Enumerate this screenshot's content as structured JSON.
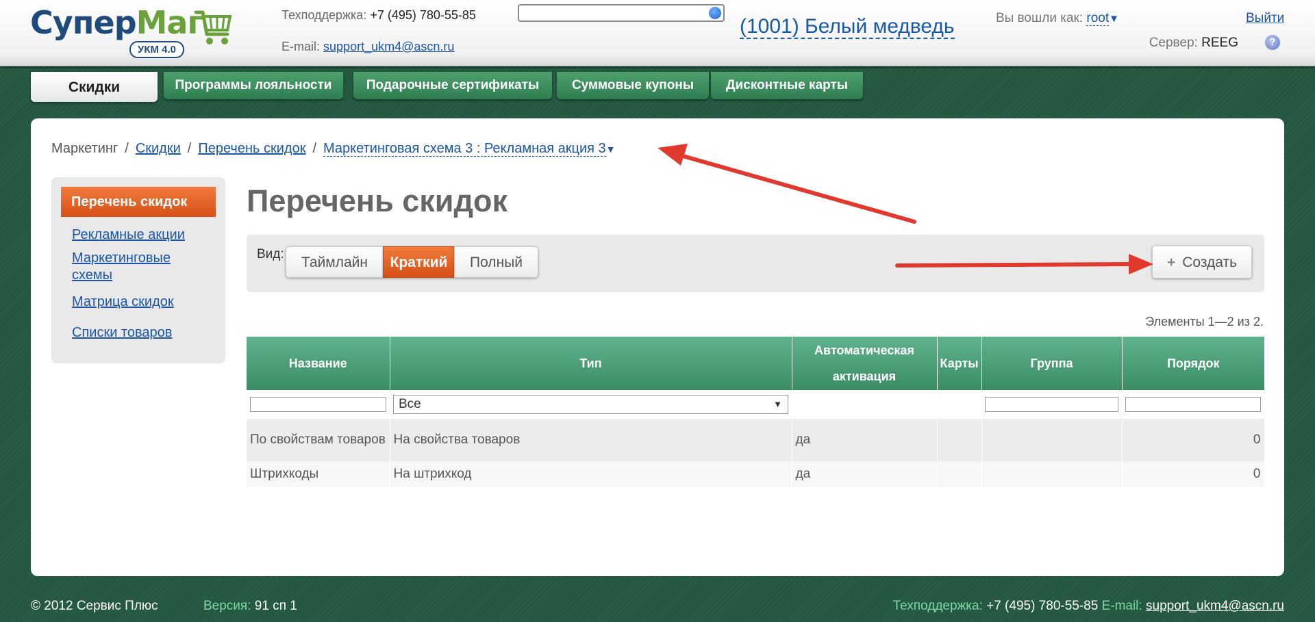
{
  "header": {
    "logo_part1": "Супер",
    "logo_part2": "Маг",
    "logo_badge": "УКМ 4.0",
    "support_label": "Техподдержка:",
    "support_phone": "+7 (495) 780-55-85",
    "email_label": "E-mail:",
    "email": "support_ukm4@ascn.ru",
    "search_value": "",
    "store": "(1001) Белый медведь",
    "logged_in_label": "Вы вошли как:",
    "user": "root",
    "logout": "Выйти",
    "server_label": "Сервер:",
    "server": "REEG",
    "help": "?"
  },
  "tabs": [
    {
      "label": "Скидки",
      "active": true
    },
    {
      "label": "Программы лояльности"
    },
    {
      "label": "Подарочные сертификаты"
    },
    {
      "label": "Суммовые купоны"
    },
    {
      "label": "Дисконтные карты"
    }
  ],
  "breadcrumb": [
    "Маркетинг",
    "Скидки",
    "Перечень скидок",
    "Маркетинговая схема 3 : Рекламная акция 3"
  ],
  "breadcrumb_sep": "/",
  "sidebar": {
    "active": "Перечень скидок",
    "items": [
      "Рекламные акции",
      "Маркетинговые схемы",
      "Матрица скидок",
      "Списки товаров"
    ]
  },
  "page_title": "Перечень скидок",
  "view": {
    "label": "Вид:",
    "options": [
      "Таймлайн",
      "Краткий",
      "Полный"
    ],
    "selected": "Краткий"
  },
  "create_button": "Создать",
  "counter": "Элементы 1—2 из 2.",
  "table": {
    "columns": [
      "Название",
      "Тип",
      "Автоматическая активация",
      "Карты",
      "Группа",
      "Порядок"
    ],
    "type_filter": "Все",
    "rows": [
      {
        "name": "По свойствам товаров",
        "type": "На свойства товаров",
        "auto": "да",
        "cards": "",
        "group": "",
        "order": "0"
      },
      {
        "name": "Штрихкоды",
        "type": "На штрихкод",
        "auto": "да",
        "cards": "",
        "group": "",
        "order": "0"
      }
    ]
  },
  "footer": {
    "copyright": "© 2012 Сервис Плюс",
    "version_label": "Версия:",
    "version": "91 сп 1",
    "support_label": "Техподдержка:",
    "support_phone": "+7 (495) 780-55-85",
    "email_label": "E-mail:",
    "email": "support_ukm4@ascn.ru"
  },
  "colors": {
    "background": "#245840",
    "accent_orange": "#e0632a",
    "header_green": "#4fa06f",
    "link_blue": "#1a55a8",
    "annotation_red": "#e03a2e"
  }
}
